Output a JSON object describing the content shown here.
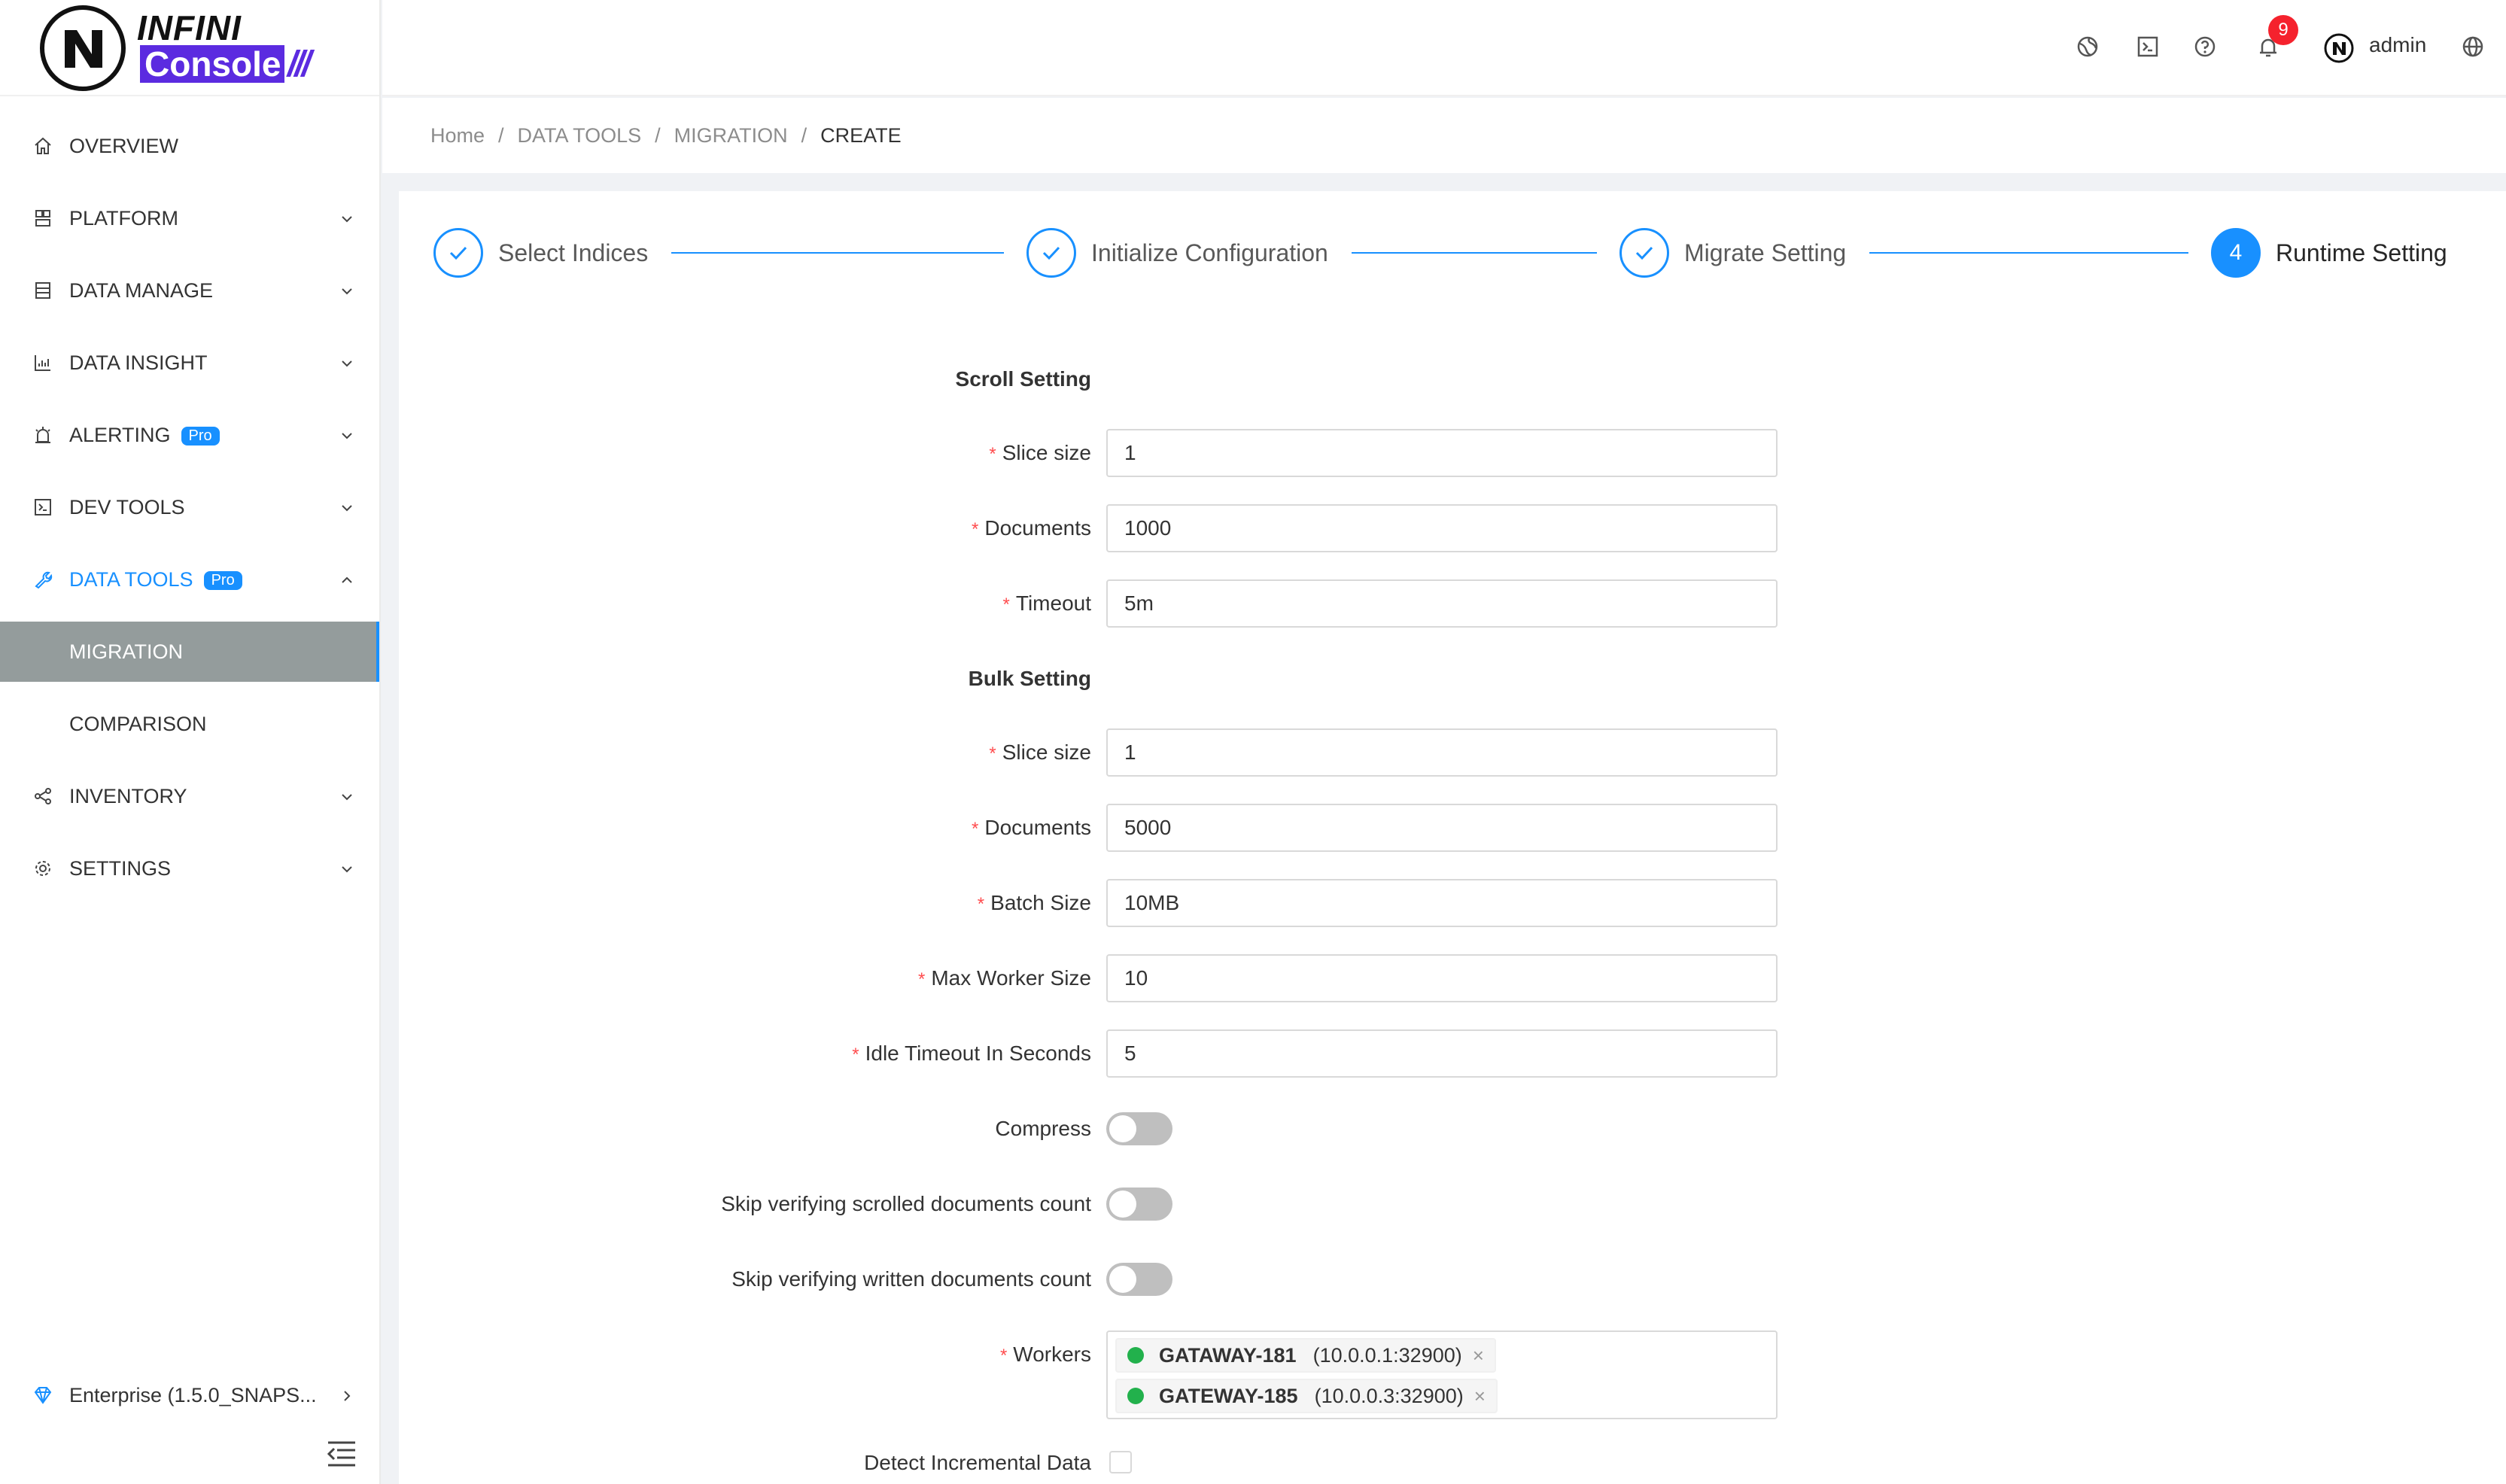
{
  "brand": {
    "top": "INFINI",
    "bottom": "Console",
    "slashes": "///"
  },
  "sidebar": {
    "items": [
      {
        "label": "OVERVIEW"
      },
      {
        "label": "PLATFORM"
      },
      {
        "label": "DATA MANAGE"
      },
      {
        "label": "DATA INSIGHT"
      },
      {
        "label": "ALERTING",
        "badge": "Pro"
      },
      {
        "label": "DEV TOOLS"
      },
      {
        "label": "DATA TOOLS",
        "badge": "Pro"
      },
      {
        "label": "INVENTORY"
      },
      {
        "label": "SETTINGS"
      }
    ],
    "sub_items": [
      {
        "label": "MIGRATION"
      },
      {
        "label": "COMPARISON"
      }
    ],
    "version": "Enterprise (1.5.0_SNAPS..."
  },
  "header": {
    "notification_count": "9",
    "user": "admin"
  },
  "breadcrumb": [
    "Home",
    "DATA TOOLS",
    "MIGRATION",
    "CREATE"
  ],
  "breadcrumb_sep": "/",
  "steps": [
    {
      "title": "Select Indices",
      "status": "finish"
    },
    {
      "title": "Initialize Configuration",
      "status": "finish"
    },
    {
      "title": "Migrate Setting",
      "status": "finish"
    },
    {
      "title": "Runtime Setting",
      "status": "process",
      "number": "4"
    }
  ],
  "form": {
    "scroll_title": "Scroll Setting",
    "scroll": {
      "slice_size": {
        "label": "Slice size",
        "value": "1"
      },
      "documents": {
        "label": "Documents",
        "value": "1000"
      },
      "timeout": {
        "label": "Timeout",
        "value": "5m"
      }
    },
    "bulk_title": "Bulk Setting",
    "bulk": {
      "slice_size": {
        "label": "Slice size",
        "value": "1"
      },
      "documents": {
        "label": "Documents",
        "value": "5000"
      },
      "batch_size": {
        "label": "Batch Size",
        "value": "10MB"
      },
      "max_worker_size": {
        "label": "Max Worker Size",
        "value": "10"
      },
      "idle_timeout": {
        "label": "Idle Timeout In Seconds",
        "value": "5"
      }
    },
    "compress": {
      "label": "Compress",
      "on": false
    },
    "skip_scrolled": {
      "label": "Skip verifying scrolled documents count",
      "on": false
    },
    "skip_written": {
      "label": "Skip verifying written documents count",
      "on": false
    },
    "workers": {
      "label": "Workers",
      "items": [
        {
          "name": "GATAWAY-181",
          "addr": "(10.0.0.1:32900)",
          "close": "×"
        },
        {
          "name": "GATEWAY-185",
          "addr": "(10.0.0.3:32900)",
          "close": "×"
        }
      ]
    },
    "detect_incremental": {
      "label": "Detect Incremental Data",
      "checked": false
    },
    "required_mark": "*"
  },
  "colors": {
    "primary": "#1890ff",
    "brand": "#5b2be0",
    "badge": "#f5222d",
    "online": "#22b14c",
    "required": "#ff4d4f"
  }
}
